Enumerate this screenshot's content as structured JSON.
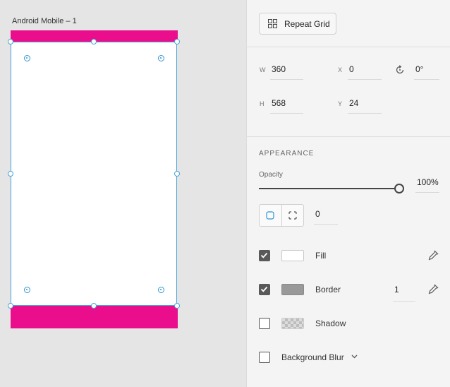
{
  "canvas": {
    "artboard_title": "Android Mobile – 1",
    "bar_color": "#ea0e8c",
    "selection_color": "#4aa3d8"
  },
  "toolbar": {
    "repeat_grid_label": "Repeat Grid",
    "repeat_grid_icon": "repeat-grid-icon"
  },
  "transform": {
    "w_label": "W",
    "w_value": "360",
    "h_label": "H",
    "h_value": "568",
    "x_label": "X",
    "x_value": "0",
    "y_label": "Y",
    "y_value": "24",
    "rotation_icon": "rotate-icon",
    "rotation_value": "0°"
  },
  "appearance": {
    "section_title": "APPEARANCE",
    "opacity_label": "Opacity",
    "opacity_value": "100%",
    "opacity_fraction": 1.0,
    "corner_radius_value": "0",
    "fill": {
      "label": "Fill",
      "checked": true,
      "color": "#ffffff"
    },
    "border": {
      "label": "Border",
      "checked": true,
      "color": "#999999",
      "width": "1"
    },
    "shadow": {
      "label": "Shadow",
      "checked": false
    },
    "background_blur": {
      "label": "Background Blur",
      "checked": false
    }
  }
}
